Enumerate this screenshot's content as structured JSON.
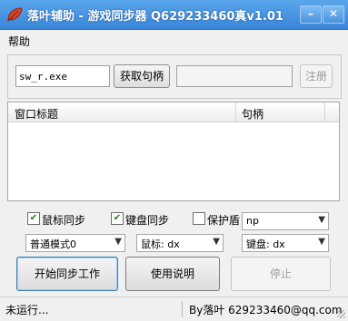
{
  "window": {
    "title": "落叶辅助 - 游戏同步器 Q629233460真v1.01",
    "icon": "leaf-icon",
    "minimize_glyph": "–",
    "close_glyph": "✕"
  },
  "menu": {
    "help": "帮助"
  },
  "top": {
    "exe_input_value": "sw_r.exe",
    "get_handle_label": "获取句柄",
    "handle_value": "",
    "register_label": "注册"
  },
  "list": {
    "columns": [
      "窗口标题",
      "句柄"
    ],
    "rows": []
  },
  "options": {
    "mouse_sync": {
      "label": "鼠标同步",
      "checked": true
    },
    "keyboard_sync": {
      "label": "键盘同步",
      "checked": true
    },
    "protect_shield": {
      "label": "保护盾",
      "checked": false
    },
    "process_select": "np",
    "mode_select": "普通模式0",
    "mouse_select": "鼠标: dx",
    "keyboard_select": "键盘: dx"
  },
  "buttons": {
    "start": "开始同步工作",
    "instructions": "使用说明",
    "stop": "停止"
  },
  "status": {
    "left": "未运行...",
    "right": "By落叶 629233460@qq.com"
  },
  "colors": {
    "titlebar": "#4a96e2",
    "check": "#1a7a1a",
    "disabled_text": "#9a9a9a"
  }
}
